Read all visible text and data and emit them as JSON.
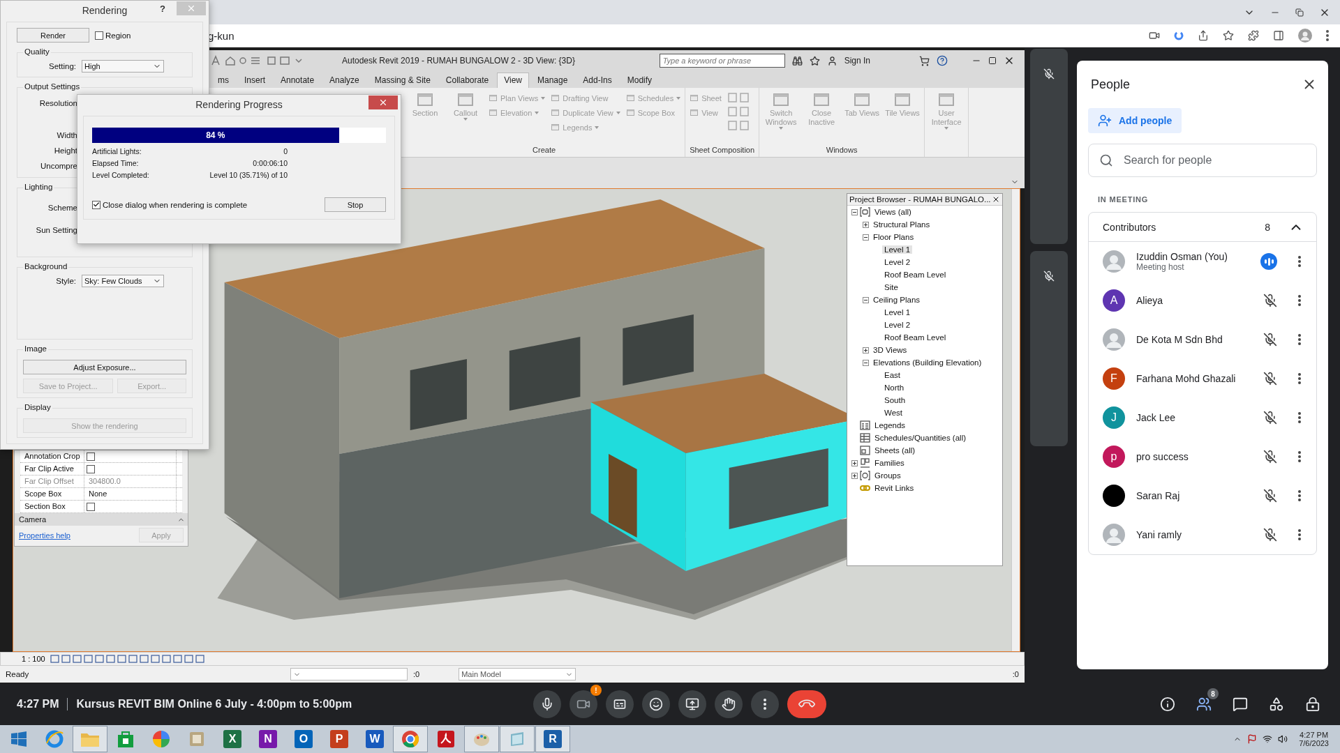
{
  "browser": {
    "address_text": "g-kun"
  },
  "rendering_dialog": {
    "title": "Rendering",
    "help": "?",
    "render_button": "Render",
    "region": {
      "label": "Region",
      "checked": false
    },
    "quality": {
      "legend": "Quality",
      "label": "Setting:",
      "value": "High"
    },
    "output": {
      "legend": "Output Settings",
      "labels": [
        "Resolution",
        "Width",
        "Height",
        "Uncompre"
      ]
    },
    "lighting": {
      "legend": "Lighting",
      "labels": [
        "Scheme",
        "Sun Setting"
      ]
    },
    "background": {
      "legend": "Background",
      "label": "Style:",
      "value": "Sky: Few Clouds"
    },
    "image": {
      "legend": "Image",
      "buttons": [
        {
          "label": "Adjust Exposure...",
          "disabled": false
        },
        {
          "label": "Save to Project...",
          "disabled": true
        },
        {
          "label": "Export...",
          "disabled": true
        }
      ]
    },
    "display": {
      "legend": "Display",
      "button": {
        "label": "Show the rendering",
        "disabled": true
      }
    }
  },
  "progress_dialog": {
    "title": "Rendering Progress",
    "level": 0.84,
    "percent": "84 %",
    "rows": [
      {
        "label": "Artificial Lights:",
        "value": "0"
      },
      {
        "label": "Elapsed Time:",
        "value": "0:00:06:10"
      },
      {
        "label": "Level Completed:",
        "value": "Level 10 (35.71%) of 10"
      }
    ],
    "close_option": {
      "label": "Close dialog when rendering is complete",
      "checked": true
    },
    "stop_button": "Stop"
  },
  "revit": {
    "title": "Autodesk Revit 2019 - RUMAH BUNGALOW 2 - 3D View: {3D}",
    "search_placeholder": "Type a keyword or phrase",
    "sign_in": "Sign In",
    "tabs": [
      {
        "label": "ms",
        "selected": false
      },
      {
        "label": "Insert",
        "selected": false
      },
      {
        "label": "Annotate",
        "selected": false
      },
      {
        "label": "Analyze",
        "selected": false
      },
      {
        "label": "Massing & Site",
        "selected": false
      },
      {
        "label": "Collaborate",
        "selected": false
      },
      {
        "label": "View",
        "selected": true
      },
      {
        "label": "Manage",
        "selected": false
      },
      {
        "label": "Add-Ins",
        "selected": false
      },
      {
        "label": "Modify",
        "selected": false
      }
    ],
    "ribbon": {
      "disabled": true,
      "panels": [
        {
          "label": "Create",
          "items": [
            {
              "kind": "large",
              "label": "Section",
              "dropdown": false
            },
            {
              "kind": "large",
              "label": "Callout",
              "dropdown": true
            },
            {
              "kind": "stack",
              "entries": [
                {
                  "label": "Plan Views",
                  "dropdown": true
                },
                {
                  "label": "Elevation",
                  "dropdown": true
                }
              ]
            },
            {
              "kind": "stack",
              "entries": [
                {
                  "label": "Drafting View",
                  "dropdown": false
                },
                {
                  "label": "Duplicate View",
                  "dropdown": true
                },
                {
                  "label": "Legends",
                  "dropdown": true
                }
              ]
            },
            {
              "kind": "stack",
              "entries": [
                {
                  "label": "Schedules",
                  "dropdown": true
                },
                {
                  "label": "Scope Box",
                  "dropdown": false
                }
              ]
            }
          ]
        },
        {
          "label": "Sheet Composition",
          "items": [
            {
              "kind": "stack",
              "entries": [
                {
                  "label": "Sheet",
                  "dropdown": false
                },
                {
                  "label": "View",
                  "dropdown": false
                }
              ]
            },
            {
              "kind": "icon_grid"
            }
          ]
        },
        {
          "label": "Windows",
          "items": [
            {
              "kind": "large",
              "label": "Switch Windows",
              "dropdown": true
            },
            {
              "kind": "large",
              "label": "Close Inactive",
              "dropdown": false
            },
            {
              "kind": "large",
              "label": "Tab Views",
              "dropdown": false
            },
            {
              "kind": "large",
              "label": "Tile Views",
              "dropdown": false
            }
          ]
        },
        {
          "items": [
            {
              "kind": "large",
              "label": "User Interface",
              "dropdown": true
            }
          ]
        }
      ]
    },
    "properties": {
      "rows": [
        {
          "kind": "checkbox",
          "label": "Annotation Crop",
          "checked": false,
          "disabled": false
        },
        {
          "kind": "checkbox",
          "label": "Far Clip Active",
          "checked": false,
          "disabled": false
        },
        {
          "kind": "text",
          "label": "Far Clip Offset",
          "value": "304800.0",
          "disabled": true
        },
        {
          "kind": "text",
          "label": "Scope Box",
          "value": "None",
          "disabled": false
        },
        {
          "kind": "checkbox",
          "label": "Section Box",
          "checked": false,
          "disabled": false
        }
      ],
      "group": "Camera",
      "help_link": "Properties help",
      "apply_button": "Apply"
    },
    "project_browser": {
      "title": "Project Browser - RUMAH BUNGALO...",
      "tree": [
        {
          "label": "Views (all)",
          "kind": "views",
          "expanded": true,
          "selected": false,
          "children": [
            {
              "label": "Structural Plans",
              "expanded": false,
              "selected": false
            },
            {
              "label": "Floor Plans",
              "expanded": true,
              "selected": false,
              "children": [
                {
                  "label": "Level 1",
                  "selected": true
                },
                {
                  "label": "Level 2",
                  "selected": false
                },
                {
                  "label": "Roof Beam Level",
                  "selected": false
                },
                {
                  "label": "Site",
                  "selected": false
                }
              ]
            },
            {
              "label": "Ceiling Plans",
              "expanded": true,
              "selected": false,
              "children": [
                {
                  "label": "Level 1",
                  "selected": false
                },
                {
                  "label": "Level 2",
                  "selected": false
                },
                {
                  "label": "Roof Beam Level",
                  "selected": false
                }
              ]
            },
            {
              "label": "3D Views",
              "expanded": false,
              "selected": false
            },
            {
              "label": "Elevations (Building Elevation)",
              "expanded": true,
              "selected": false,
              "children": [
                {
                  "label": "East",
                  "selected": false
                },
                {
                  "label": "North",
                  "selected": false
                },
                {
                  "label": "South",
                  "selected": false
                },
                {
                  "label": "West",
                  "selected": false
                }
              ]
            }
          ]
        },
        {
          "label": "Legends",
          "kind": "legends",
          "selected": false
        },
        {
          "label": "Schedules/Quantities (all)",
          "kind": "schedules",
          "selected": false
        },
        {
          "label": "Sheets (all)",
          "kind": "sheets",
          "selected": false
        },
        {
          "label": "Families",
          "kind": "families",
          "expanded": false,
          "selected": false
        },
        {
          "label": "Groups",
          "kind": "groups",
          "expanded": false,
          "selected": false
        },
        {
          "label": "Revit Links",
          "kind": "links",
          "selected": false
        }
      ]
    },
    "scale": "1 : 100",
    "status": {
      "text": "Ready",
      "selection_count": ":0",
      "model": "Main Model",
      "filter_count": ":0"
    }
  },
  "meet": {
    "side_tiles": [
      {
        "muted": true
      },
      {
        "muted": true
      }
    ],
    "time": "4:27 PM",
    "meeting_title": "Kursus REVIT BIM Online 6 July - 4:00pm to 5:00pm",
    "camera_alert": "!",
    "people_count_badge": "8",
    "people_panel": {
      "title": "People",
      "add_button": "Add people",
      "search_placeholder": "Search for people",
      "section": "IN MEETING",
      "group": {
        "label": "Contributors",
        "count": "8",
        "expanded": true
      },
      "participants": [
        {
          "name": "Izuddin Osman (You)",
          "subtitle": "Meeting host",
          "muted": false
        },
        {
          "name": "Alieya",
          "kind": "letter",
          "letter": "A",
          "color": "#5e35b1",
          "muted": true
        },
        {
          "name": "De Kota M Sdn Bhd",
          "muted": true
        },
        {
          "name": "Farhana Mohd Ghazali",
          "kind": "letter",
          "letter": "F",
          "color": "#c4400f",
          "muted": true
        },
        {
          "name": "Jack Lee",
          "kind": "letter",
          "letter": "J",
          "color": "#10939d",
          "muted": true
        },
        {
          "name": "pro success",
          "kind": "letter",
          "letter": "p",
          "color": "#c2185b",
          "muted": true
        },
        {
          "name": "Saran Raj",
          "kind": "plain",
          "color": "#000000",
          "muted": true
        },
        {
          "name": "Yani ramly",
          "muted": true
        }
      ]
    }
  },
  "taskbar": {
    "apps": [
      {
        "kind": "start",
        "active": false
      },
      {
        "kind": "ie",
        "active": false
      },
      {
        "kind": "folder",
        "active": true
      },
      {
        "kind": "store",
        "active": false
      },
      {
        "kind": "pinwheel",
        "active": false
      },
      {
        "kind": "scanner",
        "active": false
      },
      {
        "kind": "letter",
        "glyph": "X",
        "color": "#1e7145",
        "active": false
      },
      {
        "kind": "letter",
        "glyph": "N",
        "color": "#7719aa",
        "active": false
      },
      {
        "kind": "letter",
        "glyph": "O",
        "color": "#0364b8",
        "active": false
      },
      {
        "kind": "letter",
        "glyph": "P",
        "color": "#c43e1c",
        "active": false
      },
      {
        "kind": "letter",
        "glyph": "W",
        "color": "#185abd",
        "active": false
      },
      {
        "kind": "chrome",
        "active": true
      },
      {
        "kind": "pdf",
        "active": false
      },
      {
        "kind": "palette",
        "active": true
      },
      {
        "kind": "sketch",
        "active": true
      },
      {
        "kind": "letter",
        "glyph": "R",
        "color": "#1b5fa8",
        "active": true
      }
    ],
    "time": "4:27 PM",
    "date": "7/6/2023"
  }
}
